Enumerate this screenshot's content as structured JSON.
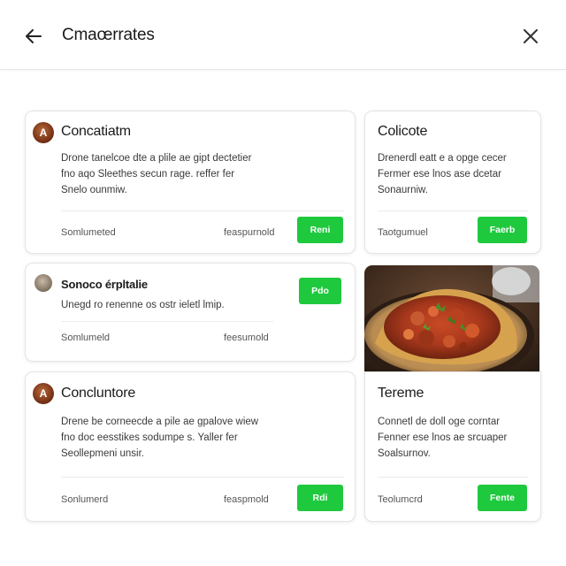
{
  "header": {
    "title": "Cmaœrrates",
    "back_icon": "arrow-left-icon",
    "close_icon": "close-icon"
  },
  "cards": [
    {
      "title": "Concatiatm",
      "avatar_letter": "A",
      "body_lines": [
        "Drone tanelcoe dte a plile ae gipt dectetier",
        "fno aqo Sleethes secun rage. reffer fer",
        "Snelo ounmiw."
      ],
      "meta_left": "Somlumeted",
      "meta_right": "feaspurnold",
      "button": "Reni"
    },
    {
      "title": "Colicote",
      "body_lines": [
        "Drenerdl eatt e a opge cecer",
        "Fermer ese lnos ase dcetar",
        "Sonaurniw."
      ],
      "meta_left": "Taotgumuel",
      "button": "Faerb"
    },
    {
      "title": "Sonoco érpltalie",
      "body_lines": [
        "Unegd ro renenne os ostr ieletl lmip."
      ],
      "meta_left": "Somlumeld",
      "meta_right": "feesumold",
      "button": "Pdo"
    },
    {
      "title": "Concluntore",
      "avatar_letter": "A",
      "body_lines": [
        "Drene be corneecde a pile ae gpalove wiew",
        "fno doc eesstikes sodumpe s. Yaller fer",
        "Seollepmeni unsir."
      ],
      "meta_left": "Sonlumerd",
      "meta_right": "feaspmold",
      "button": "Rdi"
    },
    {
      "title": "Tereme",
      "body_lines": [
        "Connetl de doll oge corntar",
        "Fenner ese lnos ae srcuaper",
        "Soalsurnov."
      ],
      "meta_left": "Teolumcrd",
      "button": "Fente"
    }
  ],
  "colors": {
    "accent": "#1fc93e",
    "card_border": "#e4e4e4"
  }
}
